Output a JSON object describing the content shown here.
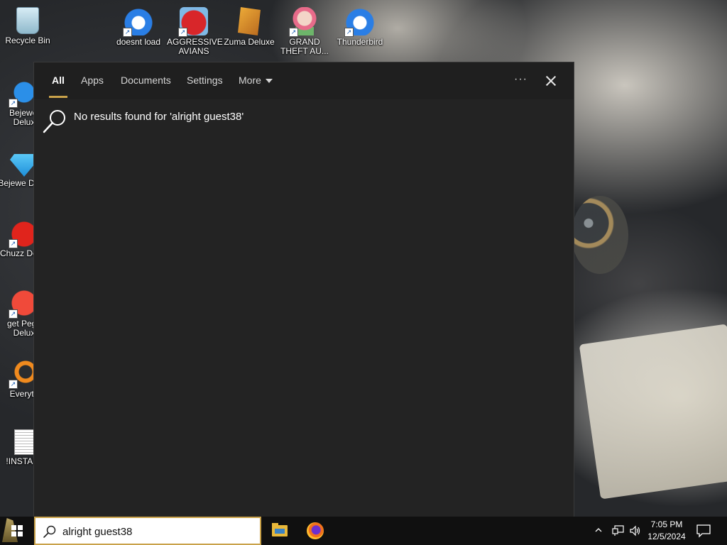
{
  "desktop": {
    "icons": [
      {
        "label": "Recycle Bin"
      },
      {
        "label": "doesnt load"
      },
      {
        "label": "AGGRESSIVE AVIANS"
      },
      {
        "label": "Zuma Deluxe"
      },
      {
        "label": "GRAND THEFT AU..."
      },
      {
        "label": "Thunderbird"
      },
      {
        "label": "Bejewel Delux"
      },
      {
        "label": "Bejewe Delux"
      },
      {
        "label": "Chuzz Delux"
      },
      {
        "label": "get Pegg Delux"
      },
      {
        "label": "Everyth"
      },
      {
        "label": "!INSTALL"
      }
    ]
  },
  "search_flyout": {
    "tabs": [
      {
        "label": "All",
        "active": true
      },
      {
        "label": "Apps"
      },
      {
        "label": "Documents"
      },
      {
        "label": "Settings"
      },
      {
        "label": "More"
      }
    ],
    "more_options_label": "···",
    "result_message": "No results found for 'alright guest38'"
  },
  "taskbar": {
    "search_value": "alright guest38",
    "pinned_apps": [
      "file-explorer",
      "firefox"
    ],
    "clock_time": "7:05 PM",
    "clock_date": "12/5/2024"
  },
  "colors": {
    "accent": "#c9a24a",
    "flyout_bg": "#232323",
    "taskbar_bg": "#101010"
  }
}
